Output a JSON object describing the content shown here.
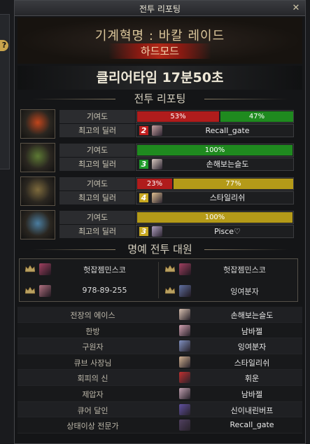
{
  "window": {
    "title": "전투 리포팅",
    "close_icon": "x-icon"
  },
  "left_panel": {
    "help_icon": "?"
  },
  "raid": {
    "name": "기계혁명 : 바칼 레이드",
    "mode": "하드모드",
    "clear_time": "클리어타임  17분50초"
  },
  "report_section": {
    "title": "전투 리포팅"
  },
  "parties": [
    {
      "contribution_label": "기여도",
      "top_dealer_label": "최고의 딜러",
      "bars": [
        {
          "value": 53,
          "label": "53%",
          "color": "#b01c1c"
        },
        {
          "value": 47,
          "label": "47%",
          "color": "#1f8a1f"
        }
      ],
      "rank": "2",
      "rank_color": "#c02020",
      "dealer": "Recall_gate",
      "portrait_color": "#c0451c"
    },
    {
      "contribution_label": "기여도",
      "top_dealer_label": "최고의 딜러",
      "bars": [
        {
          "value": 100,
          "label": "100%",
          "color": "#1f8a1f"
        }
      ],
      "rank": "3",
      "rank_color": "#1f9a2a",
      "dealer": "손해보는슬도",
      "portrait_color": "#5d7a34"
    },
    {
      "contribution_label": "기여도",
      "top_dealer_label": "최고의 딜러",
      "bars": [
        {
          "value": 23,
          "label": "23%",
          "color": "#b01c1c"
        },
        {
          "value": 77,
          "label": "77%",
          "color": "#b49a18"
        }
      ],
      "rank": "4",
      "rank_color": "#c8a820",
      "dealer": "스타일리쉬",
      "portrait_color": "#7d6a3c"
    },
    {
      "contribution_label": "기여도",
      "top_dealer_label": "최고의 딜러",
      "bars": [
        {
          "value": 100,
          "label": "100%",
          "color": "#b49a18"
        }
      ],
      "rank": "3",
      "rank_color": "#c8a820",
      "dealer": "Pisce♡",
      "portrait_color": "#4a7da0"
    }
  ],
  "honor_section": {
    "title": "명예 전투 대원"
  },
  "honor_members": [
    "헛잡젬민스코",
    "헛잡젬민스코",
    "978-89-255",
    "잉여분자"
  ],
  "awards": [
    {
      "award": "전장의 에이스",
      "player": "손해보는슬도"
    },
    {
      "award": "한방",
      "player": "남바젤"
    },
    {
      "award": "구원자",
      "player": "잉여분자"
    },
    {
      "award": "큐브 사장님",
      "player": "스타일리쉬"
    },
    {
      "award": "회피의 신",
      "player": "휘운"
    },
    {
      "award": "제압자",
      "player": "남바젤"
    },
    {
      "award": "큐어 달인",
      "player": "신이내린버프"
    },
    {
      "award": "상태이상 전문가",
      "player": "Recall_gate"
    }
  ]
}
